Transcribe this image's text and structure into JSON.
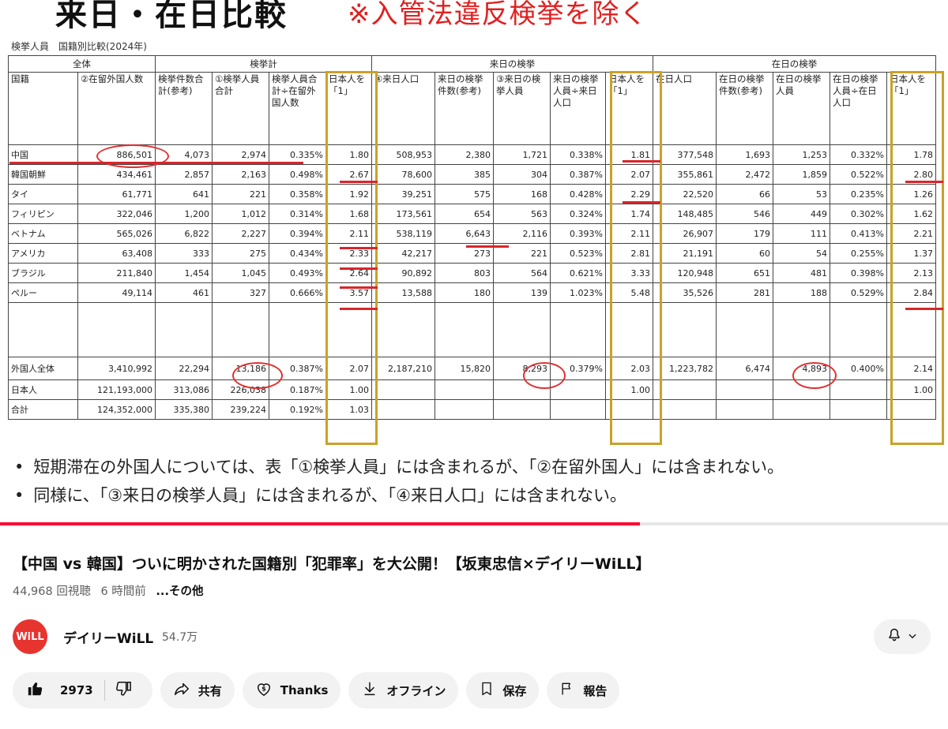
{
  "slide": {
    "title": "来日・在日比較",
    "subtitle": "※入管法違反検挙を除く",
    "caption": "検挙人員　国籍別比較(2024年)",
    "groups": {
      "all": "全体",
      "arrest_total": "検挙計",
      "rainichi": "来日の検挙",
      "zainichi": "在日の検挙"
    },
    "headers": [
      "国籍",
      "②在留外国人数",
      "検挙件数合計(参考)",
      "①検挙人員合計",
      "検挙人員合計÷在留外国人数",
      "日本人を「1」",
      "④来日人口",
      "来日の検挙件数(参考)",
      "③来日の検挙人員",
      "来日の検挙人員÷来日人口",
      "日本人を「1」",
      "在日人口",
      "在日の検挙件数(参考)",
      "在日の検挙人員",
      "在日の検挙人員÷在日人口",
      "日本人を「1」"
    ],
    "rows": [
      [
        "中国",
        "886,501",
        "4,073",
        "2,974",
        "0.335%",
        "1.80",
        "508,953",
        "2,380",
        "1,721",
        "0.338%",
        "1.81",
        "377,548",
        "1,693",
        "1,253",
        "0.332%",
        "1.78"
      ],
      [
        "韓国朝鮮",
        "434,461",
        "2,857",
        "2,163",
        "0.498%",
        "2.67",
        "78,600",
        "385",
        "304",
        "0.387%",
        "2.07",
        "355,861",
        "2,472",
        "1,859",
        "0.522%",
        "2.80"
      ],
      [
        "タイ",
        "61,771",
        "641",
        "221",
        "0.358%",
        "1.92",
        "39,251",
        "575",
        "168",
        "0.428%",
        "2.29",
        "22,520",
        "66",
        "53",
        "0.235%",
        "1.26"
      ],
      [
        "フィリピン",
        "322,046",
        "1,200",
        "1,012",
        "0.314%",
        "1.68",
        "173,561",
        "654",
        "563",
        "0.324%",
        "1.74",
        "148,485",
        "546",
        "449",
        "0.302%",
        "1.62"
      ],
      [
        "ベトナム",
        "565,026",
        "6,822",
        "2,227",
        "0.394%",
        "2.11",
        "538,119",
        "6,643",
        "2,116",
        "0.393%",
        "2.11",
        "26,907",
        "179",
        "111",
        "0.413%",
        "2.21"
      ],
      [
        "アメリカ",
        "63,408",
        "333",
        "275",
        "0.434%",
        "2.33",
        "42,217",
        "273",
        "221",
        "0.523%",
        "2.81",
        "21,191",
        "60",
        "54",
        "0.255%",
        "1.37"
      ],
      [
        "ブラジル",
        "211,840",
        "1,454",
        "1,045",
        "0.493%",
        "2.64",
        "90,892",
        "803",
        "564",
        "0.621%",
        "3.33",
        "120,948",
        "651",
        "481",
        "0.398%",
        "2.13"
      ],
      [
        "ペルー",
        "49,114",
        "461",
        "327",
        "0.666%",
        "3.57",
        "13,588",
        "180",
        "139",
        "1.023%",
        "5.48",
        "35,526",
        "281",
        "188",
        "0.529%",
        "2.84"
      ]
    ],
    "total_row": [
      "外国人全体",
      "3,410,992",
      "22,294",
      "13,186",
      "0.387%",
      "2.07",
      "2,187,210",
      "15,820",
      "8,293",
      "0.379%",
      "2.03",
      "1,223,782",
      "6,474",
      "4,893",
      "0.400%",
      "2.14"
    ],
    "japanese_row": [
      "日本人",
      "121,193,000",
      "313,086",
      "226,038",
      "0.187%",
      "1.00",
      "",
      "",
      "",
      "",
      "1.00",
      "",
      "",
      "",
      "",
      "1.00"
    ],
    "sum_row": [
      "合計",
      "124,352,000",
      "335,380",
      "239,224",
      "0.192%",
      "1.03",
      "",
      "",
      "",
      "",
      "",
      "",
      "",
      "",
      "",
      ""
    ],
    "bullets": [
      "短期滞在の外国人については、表「①検挙人員」には含まれるが、「②在留外国人」には含まれない。",
      "同様に、「③来日の検挙人員」には含まれるが、「④来日人口」には含まれない。"
    ],
    "colors": {
      "highlight_box": "#c9a227",
      "annotation_red": "#e03030"
    }
  },
  "player": {
    "progress": 0.675
  },
  "video": {
    "title": "【中国 vs 韓国】ついに明かされた国籍別「犯罪率」を大公開！【坂東忠信×デイリーWiLL】",
    "views": "44,968 回視聴",
    "age": "6 時間前",
    "more": "...その他"
  },
  "channel": {
    "avatar_text": "WiLL",
    "name": "デイリーWiLL",
    "subscribers": "54.7万",
    "avatar_color": "#e8342f"
  },
  "actions": {
    "like_count": "2973",
    "share": "共有",
    "thanks": "Thanks",
    "offline": "オフライン",
    "save": "保存",
    "report": "報告"
  },
  "icons": [
    "thumbs-up-icon",
    "thumbs-down-icon",
    "share-icon",
    "thanks-icon",
    "download-icon",
    "bookmark-icon",
    "flag-icon",
    "bell-icon",
    "chevron-down-icon"
  ]
}
